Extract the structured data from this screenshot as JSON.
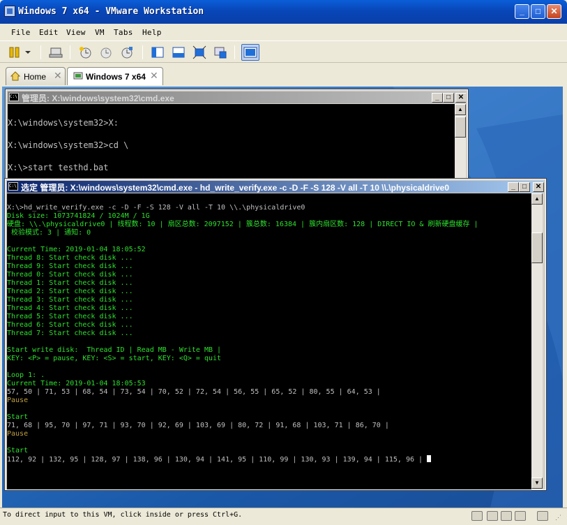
{
  "window": {
    "title": "Windows 7 x64 - VMware Workstation",
    "min_glyph": "_",
    "max_glyph": "□",
    "close_glyph": "✕"
  },
  "menu": [
    "File",
    "Edit",
    "View",
    "VM",
    "Tabs",
    "Help"
  ],
  "tabs": [
    {
      "label": "Home",
      "close": "✕"
    },
    {
      "label": "Windows 7 x64",
      "close": "✕"
    }
  ],
  "cmd1": {
    "title": "管理员: X:\\windows\\system32\\cmd.exe",
    "lines": [
      "",
      "X:\\windows\\system32>X:",
      "",
      "X:\\windows\\system32>cd \\",
      "",
      "X:\\>start testhd.bat"
    ]
  },
  "cmd2": {
    "title": "选定 管理员: X:\\windows\\system32\\cmd.exe - hd_write_verify.exe  -c -D -F -S 128 -V all -T 10 \\\\.\\physicaldrive0",
    "lines": [
      {
        "t": "",
        "c": "w"
      },
      {
        "t": "X:\\>hd_write_verify.exe -c -D -F -S 128 -V all -T 10 \\\\.\\physicaldrive0",
        "c": "w"
      },
      {
        "t": "Disk size: 1073741824 / 1024M / 1G",
        "c": "g"
      },
      {
        "t": "硬盘: \\\\.\\physicaldrive0 | 线程数: 10 | 扇区总数: 2097152 | 簇总数: 16384 | 簇内扇区数: 128 | DIRECT IO & 刷新硬盘缓存 |",
        "c": "g"
      },
      {
        "t": " 校验模式: 3 | 通知: 0",
        "c": "g"
      },
      {
        "t": "",
        "c": "w"
      },
      {
        "t": "Current Time: 2019-01-04 18:05:52",
        "c": "g"
      },
      {
        "t": "Thread 8: Start check disk ...",
        "c": "g"
      },
      {
        "t": "Thread 9: Start check disk ...",
        "c": "g"
      },
      {
        "t": "Thread 0: Start check disk ...",
        "c": "g"
      },
      {
        "t": "Thread 1: Start check disk ...",
        "c": "g"
      },
      {
        "t": "Thread 2: Start check disk ...",
        "c": "g"
      },
      {
        "t": "Thread 3: Start check disk ...",
        "c": "g"
      },
      {
        "t": "Thread 4: Start check disk ...",
        "c": "g"
      },
      {
        "t": "Thread 5: Start check disk ...",
        "c": "g"
      },
      {
        "t": "Thread 6: Start check disk ...",
        "c": "g"
      },
      {
        "t": "Thread 7: Start check disk ...",
        "c": "g"
      },
      {
        "t": "",
        "c": "w"
      },
      {
        "t": "Start write disk:  Thread ID | Read MB - Write MB |",
        "c": "g"
      },
      {
        "t": "KEY: <P> = pause, KEY: <S> = start, KEY: <Q> = quit",
        "c": "g"
      },
      {
        "t": "",
        "c": "w"
      },
      {
        "t": "Loop 1: .",
        "c": "g"
      },
      {
        "t": "Current Time: 2019-01-04 18:05:53",
        "c": "g"
      },
      {
        "t": "57, 50 | 71, 53 | 68, 54 | 73, 54 | 70, 52 | 72, 54 | 56, 55 | 65, 52 | 80, 55 | 64, 53 |",
        "c": "w"
      },
      {
        "t": "Pause",
        "c": "y"
      },
      {
        "t": "",
        "c": "w"
      },
      {
        "t": "Start",
        "c": "g"
      },
      {
        "t": "71, 68 | 95, 70 | 97, 71 | 93, 70 | 92, 69 | 103, 69 | 80, 72 | 91, 68 | 103, 71 | 86, 70 |",
        "c": "w"
      },
      {
        "t": "Pause",
        "c": "y"
      },
      {
        "t": "",
        "c": "w"
      },
      {
        "t": "Start",
        "c": "g"
      },
      {
        "t": "112, 92 | 132, 95 | 128, 97 | 138, 96 | 130, 94 | 141, 95 | 110, 99 | 130, 93 | 139, 94 | 115, 96 | ",
        "c": "w",
        "cursor": true
      }
    ]
  },
  "status": "To direct input to this VM, click inside or press Ctrl+G.",
  "colors": {
    "console_green": "#2ee02e",
    "console_gray": "#c0c0c0",
    "console_yellow": "#c0a040",
    "title_active": "#0a246a",
    "title_inactive": "#808080"
  }
}
